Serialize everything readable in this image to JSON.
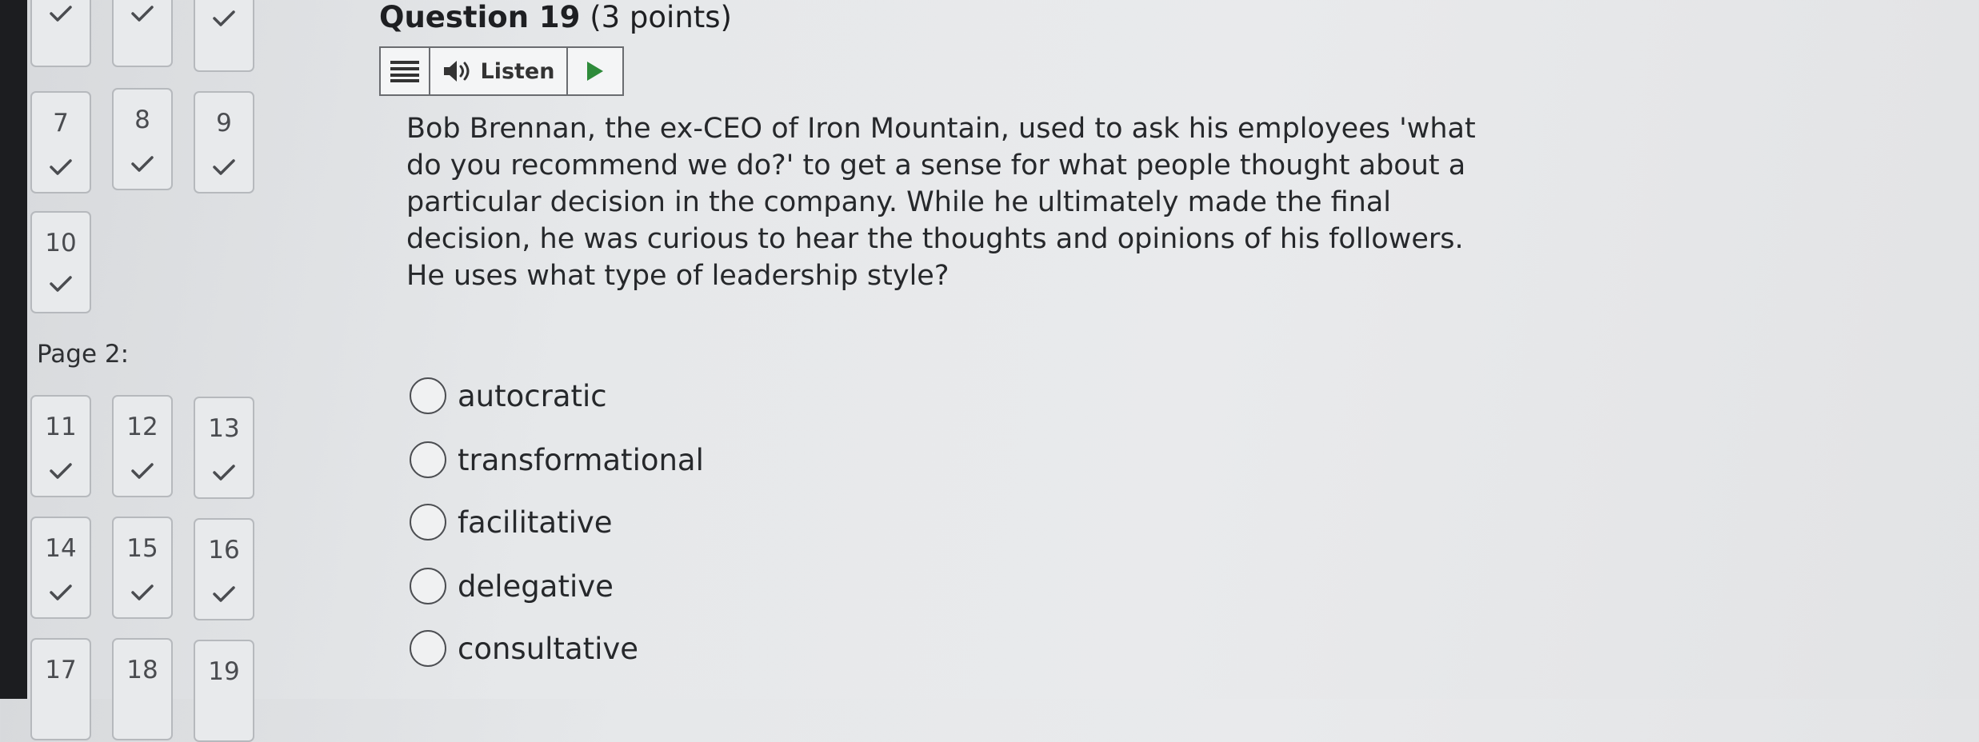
{
  "sidebar": {
    "row0": [
      {
        "number": "",
        "checked": true
      },
      {
        "number": "",
        "checked": true
      },
      {
        "number": "",
        "checked": true
      }
    ],
    "row1": [
      {
        "number": "7",
        "checked": true
      },
      {
        "number": "8",
        "checked": true
      },
      {
        "number": "9",
        "checked": true
      }
    ],
    "row2": [
      {
        "number": "10",
        "checked": true
      }
    ],
    "page2_label": "Page 2:",
    "row3": [
      {
        "number": "11",
        "checked": true
      },
      {
        "number": "12",
        "checked": true
      },
      {
        "number": "13",
        "checked": true
      }
    ],
    "row4": [
      {
        "number": "14",
        "checked": true
      },
      {
        "number": "15",
        "checked": true
      },
      {
        "number": "16",
        "checked": true
      }
    ],
    "row5": [
      {
        "number": "17",
        "checked": false
      },
      {
        "number": "18",
        "checked": false
      },
      {
        "number": "19",
        "checked": false
      }
    ]
  },
  "question": {
    "title": "Question 19",
    "points": "(3 points)",
    "text": "Bob Brennan, the ex-CEO of Iron Mountain, used to ask his employees 'what do you recommend we do?' to get a sense for what people thought about a particular decision in the company. While he ultimately made the final decision, he was curious to hear the thoughts and opinions of his followers. He uses what type of leadership style?"
  },
  "listen_toolbar": {
    "listen_label": "Listen",
    "icons": [
      "menu-icon",
      "speaker-icon",
      "play-icon"
    ],
    "play_color": "#2e8b3a"
  },
  "answers": [
    {
      "label": "autocratic",
      "selected": false
    },
    {
      "label": "transformational",
      "selected": false
    },
    {
      "label": "facilitative",
      "selected": false
    },
    {
      "label": "delegative",
      "selected": false
    },
    {
      "label": "consultative",
      "selected": false
    }
  ],
  "colors": {
    "checkmark": "#4a4c50",
    "background": "#e6e8ea"
  }
}
